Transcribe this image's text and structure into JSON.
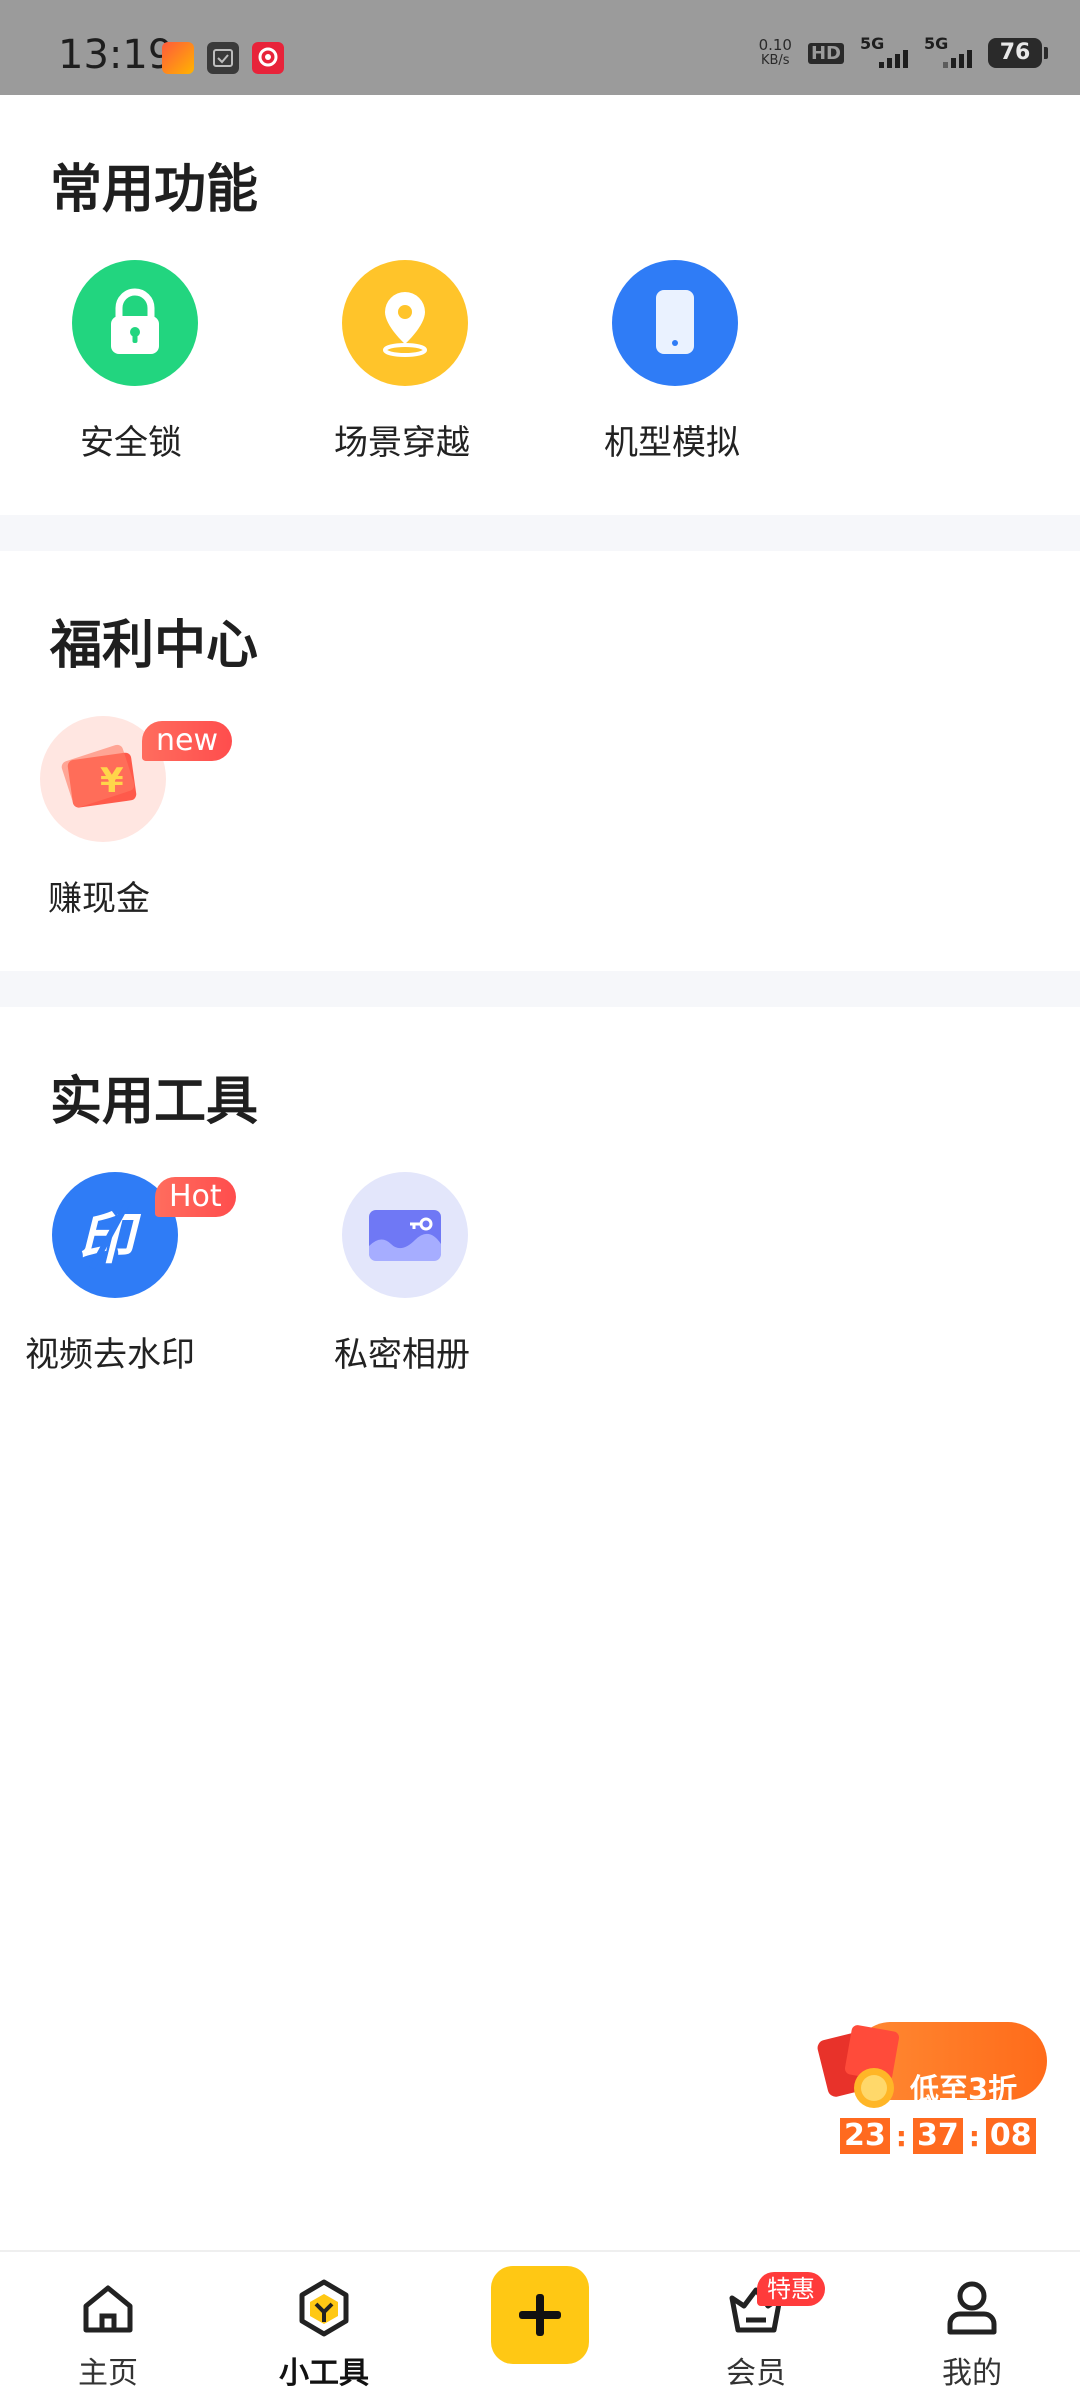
{
  "status_bar": {
    "time": "13:19",
    "net_speed_value": "0.10",
    "net_speed_unit": "KB/s",
    "hd_label": "HD",
    "sim1_label": "5G",
    "sim2_label": "5G",
    "battery": "76"
  },
  "common": {
    "title": "常用功能",
    "items": [
      {
        "label": "安全锁",
        "icon": "lock-icon",
        "color": "#22d57f"
      },
      {
        "label": "场景穿越",
        "icon": "location-pin-icon",
        "color": "#ffc42a"
      },
      {
        "label": "机型模拟",
        "icon": "phone-icon",
        "color": "#2f7cf6"
      }
    ]
  },
  "welfare": {
    "title": "福利中心",
    "items": [
      {
        "label": "赚现金",
        "icon": "red-envelope-icon",
        "badge": "new"
      }
    ]
  },
  "tools": {
    "title": "实用工具",
    "items": [
      {
        "label": "视频去水印",
        "icon": "watermark-icon",
        "badge": "Hot",
        "color": "#2f7cf6"
      },
      {
        "label": "私密相册",
        "icon": "private-album-icon",
        "color": "#e3e6fb"
      }
    ]
  },
  "promo": {
    "text": "低至3折",
    "countdown": {
      "h": "23",
      "m": "37",
      "s": "08",
      "sep": ":"
    }
  },
  "bottom_nav": {
    "items": [
      {
        "label": "主页",
        "icon": "home-icon"
      },
      {
        "label": "小工具",
        "icon": "tools-icon",
        "active": true
      },
      {
        "label": "",
        "icon": "plus-icon"
      },
      {
        "label": "会员",
        "icon": "vip-basket-icon",
        "badge": "特惠"
      },
      {
        "label": "我的",
        "icon": "profile-icon"
      }
    ]
  },
  "colors": {
    "accent_yellow": "#ffc814",
    "badge_red": "#ff4d4d",
    "promo_orange": "#ff6a1f"
  }
}
